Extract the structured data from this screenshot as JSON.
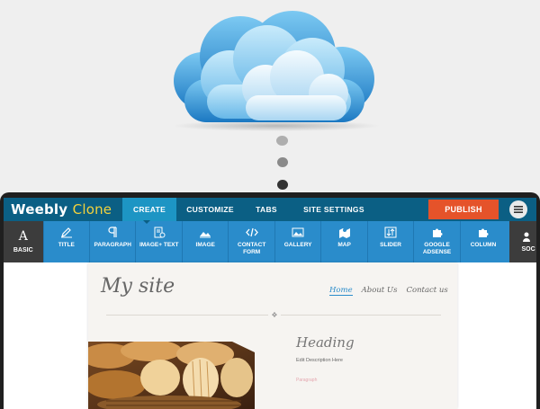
{
  "app": {
    "logo_part1": "Weebly",
    "logo_part2": "Clone"
  },
  "tabs": [
    {
      "label": "CREATE",
      "active": true
    },
    {
      "label": "CUSTOMIZE"
    },
    {
      "label": "TABS"
    },
    {
      "label": "SITE SETTINGS"
    }
  ],
  "publish_label": "PUBLISH",
  "toolbar": {
    "basic_icon": "A",
    "basic_label": "BASIC",
    "items": [
      {
        "label": "TITLE",
        "icon": "pen-icon"
      },
      {
        "label": "PARAGRAPH",
        "icon": "pilcrow-icon"
      },
      {
        "label": "IMAGE+ TEXT",
        "icon": "image-text-icon"
      },
      {
        "label": "IMAGE",
        "icon": "image-icon"
      },
      {
        "label": "CONTACT FORM",
        "icon": "code-icon"
      },
      {
        "label": "GALLERY",
        "icon": "gallery-icon"
      },
      {
        "label": "MAP",
        "icon": "map-icon"
      },
      {
        "label": "SLIDER",
        "icon": "slider-icon"
      },
      {
        "label": "GOOGLE ADSENSE",
        "icon": "puzzle-icon"
      },
      {
        "label": "COLUMN",
        "icon": "puzzle-icon"
      }
    ],
    "social_label": "SOC"
  },
  "site": {
    "title": "My site",
    "nav": [
      "Home",
      "About Us",
      "Contact us"
    ],
    "heading": "Heading",
    "description": "Edit Description Here",
    "paragraph": "Paragraph"
  },
  "colors": {
    "topbar": "#0b5f84",
    "active_tab": "#1d95c4",
    "toolbar": "#2a8ccb",
    "publish": "#e5532a",
    "logo_accent": "#f3d23c"
  }
}
